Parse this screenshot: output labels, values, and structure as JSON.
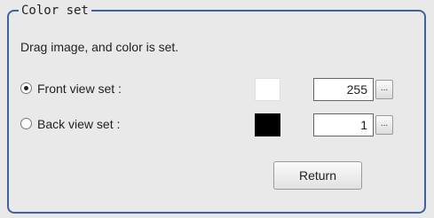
{
  "group": {
    "title": "Color set"
  },
  "instruction": "Drag image, and color is set.",
  "front": {
    "label": "Front view set :",
    "value": "255",
    "selected": true,
    "swatch_color": "#ffffff",
    "dots_label": "..."
  },
  "back": {
    "label": "Back view set :",
    "value": "1",
    "selected": false,
    "swatch_color": "#000000",
    "dots_label": "..."
  },
  "return_label": "Return"
}
